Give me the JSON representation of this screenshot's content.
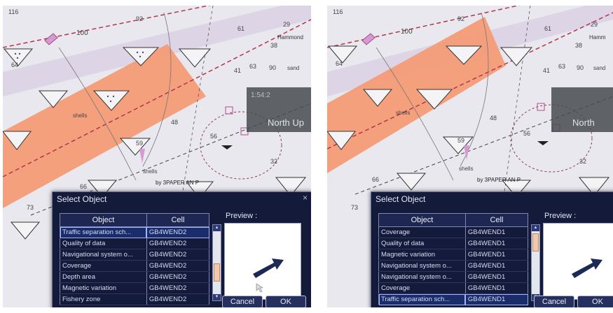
{
  "panels": [
    {
      "id": "left",
      "chart_labels": {
        "depth_116": "116",
        "depth_100": "100",
        "depth_92": "92",
        "depth_61": "61",
        "depth_29": "29",
        "place_hammond": "Hammond",
        "depth_64": "64",
        "depth_63": "63",
        "depth_38": "38",
        "depth_90": "90",
        "sand": "sand",
        "shells_1": "shells",
        "shells_2": "shells",
        "depth_48": "48",
        "depth_41": "41",
        "depth_56": "56",
        "depth_59": "59",
        "depth_32": "32",
        "depth_66": "66",
        "depth_73": "73",
        "note": "by 3PAPER AN P"
      },
      "overlay": {
        "time": "1:54:2",
        "north_up": "North Up"
      },
      "dialog": {
        "title": "Select Object",
        "close": "×",
        "col_object": "Object",
        "col_cell": "Cell",
        "preview_label": "Preview :",
        "rows": [
          {
            "object": "Traffic separation sch...",
            "cell": "GB4WEND2"
          },
          {
            "object": "Quality of data",
            "cell": "GB4WEND2"
          },
          {
            "object": "Navigational system o...",
            "cell": "GB4WEND2"
          },
          {
            "object": "Coverage",
            "cell": "GB4WEND2"
          },
          {
            "object": "Depth area",
            "cell": "GB4WEND2"
          },
          {
            "object": "Magnetic variation",
            "cell": "GB4WEND2"
          },
          {
            "object": "Fishery zone",
            "cell": "GB4WEND2"
          }
        ],
        "selected_index": 0,
        "scroll_position": 0.72,
        "cancel_label": "Cancel",
        "ok_label": "OK"
      }
    },
    {
      "id": "right",
      "chart_labels": {
        "depth_116": "116",
        "depth_100": "100",
        "depth_92": "92",
        "depth_61": "61",
        "depth_29": "29",
        "place_hammond": "Hamm",
        "depth_64": "64",
        "depth_63": "63",
        "depth_38": "38",
        "depth_90": "90",
        "sand": "sand",
        "shells_1": "shells",
        "shells_2": "shells",
        "depth_48": "48",
        "depth_41": "41",
        "depth_56": "56",
        "depth_59": "59",
        "depth_32": "32",
        "depth_66": "66",
        "depth_73": "73",
        "note": "by 3PAPER AN P"
      },
      "overlay": {
        "time": "",
        "north_up": "North"
      },
      "dialog": {
        "title": "Select Object",
        "close": "",
        "col_object": "Object",
        "col_cell": "Cell",
        "preview_label": "Preview :",
        "rows": [
          {
            "object": "Coverage",
            "cell": "GB4WEND1"
          },
          {
            "object": "Quality of data",
            "cell": "GB4WEND1"
          },
          {
            "object": "Magnetic variation",
            "cell": "GB4WEND1"
          },
          {
            "object": "Navigational system o...",
            "cell": "GB4WEND1"
          },
          {
            "object": "Navigational system o...",
            "cell": "GB4WEND1"
          },
          {
            "object": "Coverage",
            "cell": "GB4WEND1"
          },
          {
            "object": "Traffic separation sch...",
            "cell": "GB4WEND1"
          }
        ],
        "selected_index": 6,
        "scroll_position": 0.05,
        "cancel_label": "Cancel",
        "ok_label": "OK"
      }
    }
  ],
  "colors": {
    "chart_bg": "#e9e9ef",
    "traffic_zone": "#f59870",
    "dashed_line": "#b2354a",
    "lane_band": "#d9cfe3",
    "dialog_bg": "#141b3a",
    "arrow": "#1b2a55"
  }
}
